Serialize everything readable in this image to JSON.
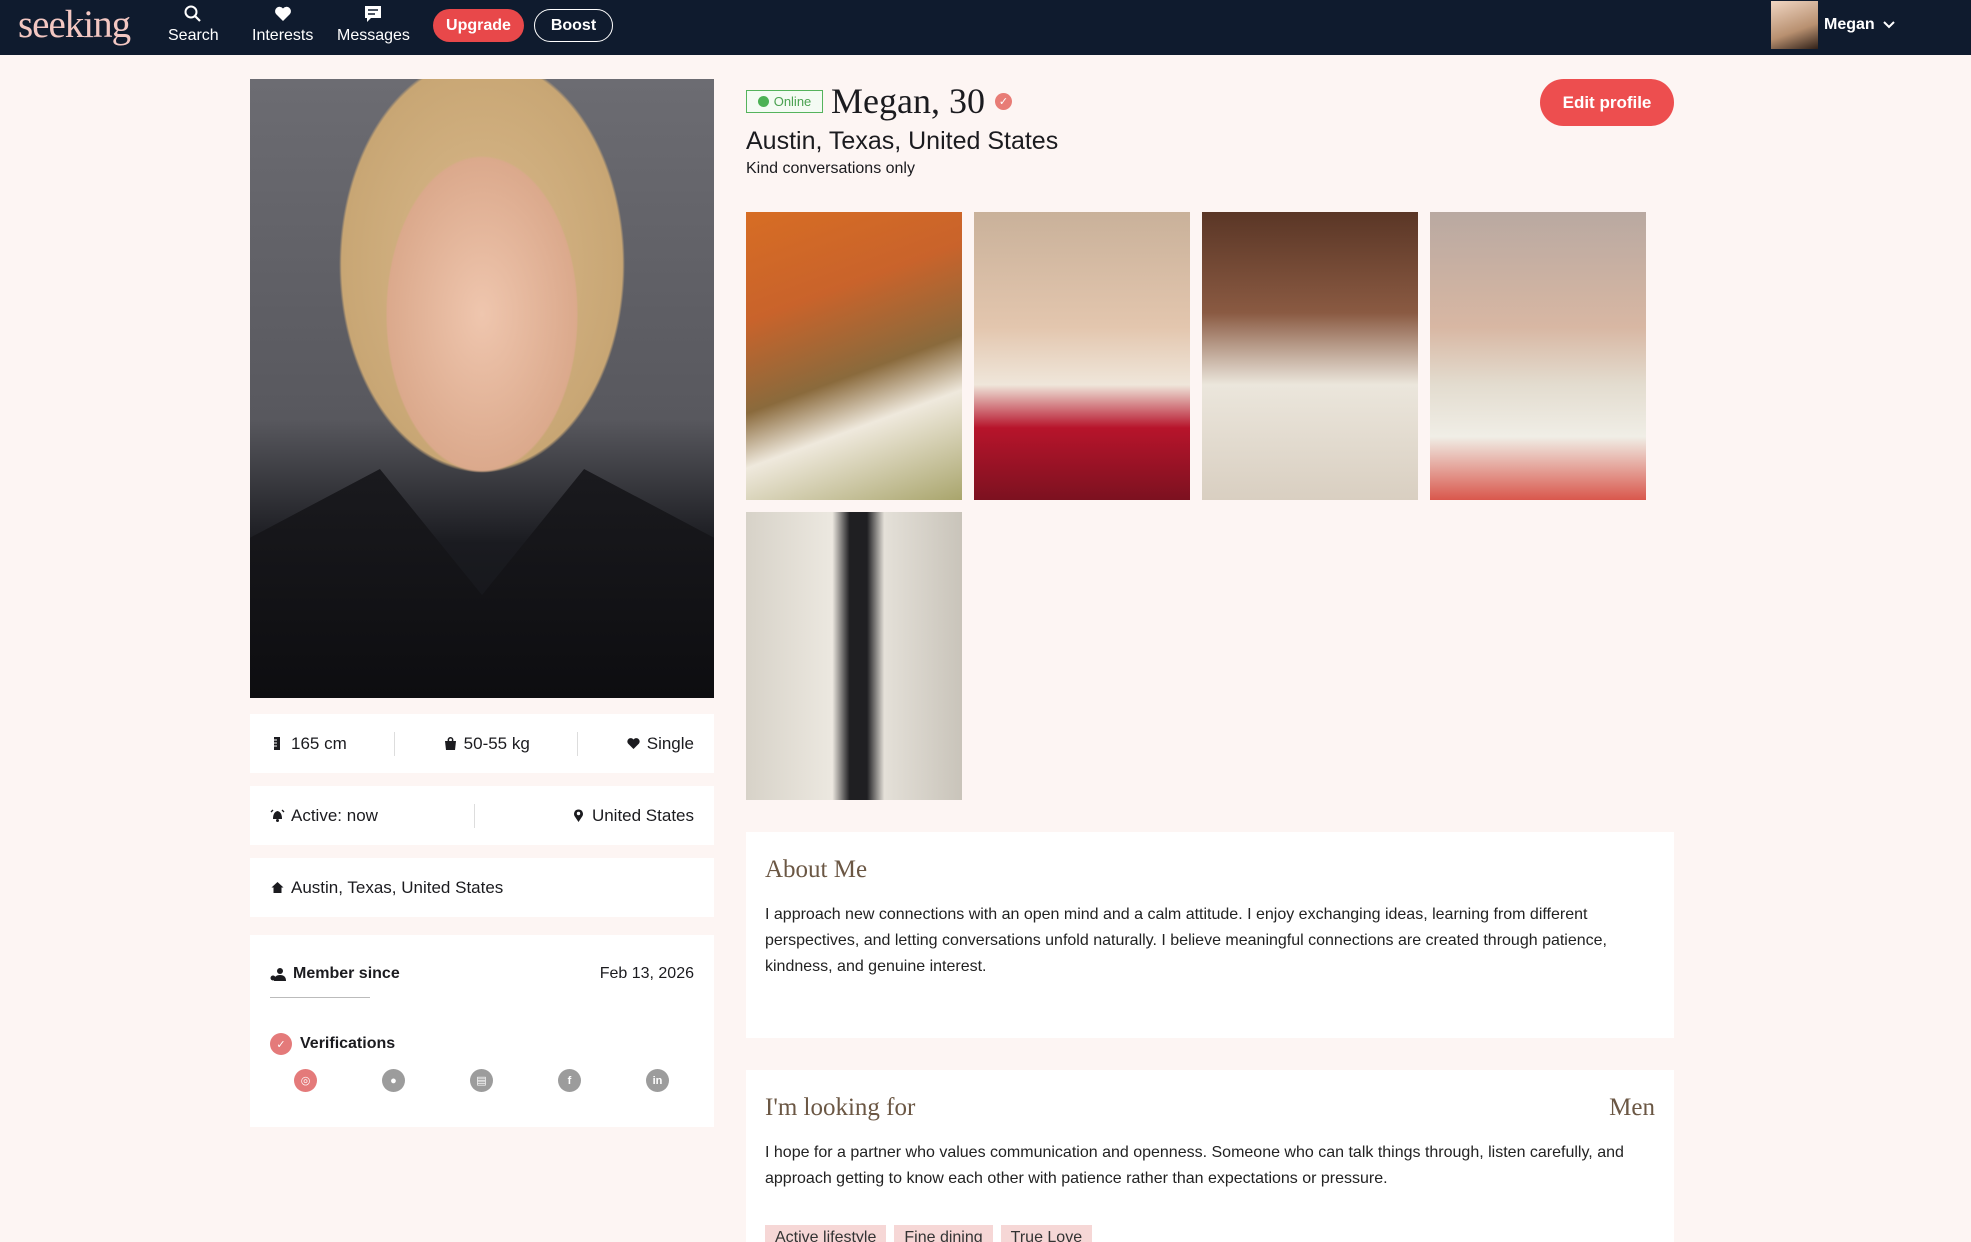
{
  "nav": {
    "logo": "seeking",
    "items": [
      {
        "label": "Search",
        "icon": "search-icon"
      },
      {
        "label": "Interests",
        "icon": "heart-icon"
      },
      {
        "label": "Messages",
        "icon": "message-icon"
      }
    ],
    "upgrade_label": "Upgrade",
    "boost_label": "Boost",
    "user_name": "Megan"
  },
  "profile": {
    "online_label": "Online",
    "name_age": "Megan, 30",
    "location": "Austin, Texas, United States",
    "tagline": "Kind conversations only",
    "edit_label": "Edit profile"
  },
  "stats": {
    "height": "165 cm",
    "weight": "50-55 kg",
    "status": "Single",
    "active": "Active: now",
    "country": "United States",
    "home": "Austin, Texas, United States",
    "member_since_label": "Member since",
    "member_since_date": "Feb 13, 2026",
    "verifications_label": "Verifications"
  },
  "about": {
    "title": "About Me",
    "text": "I approach new connections with an open mind and a calm attitude. I enjoy exchanging ideas, learning from different perspectives, and letting conversations unfold naturally. I believe meaningful connections are created through patience, kindness, and genuine interest."
  },
  "looking": {
    "title": "I'm looking for",
    "target": "Men",
    "text": "I hope for a partner who values communication and openness. Someone who can talk things through, listen carefully, and approach getting to know each other with patience rather than expectations or pressure.",
    "tags": [
      "Active lifestyle",
      "Fine dining",
      "True Love"
    ]
  },
  "colors": {
    "nav_bg": "#0f1b2e",
    "accent": "#ed4e4f",
    "online": "#4cb154",
    "page_bg": "#fdf5f3"
  }
}
